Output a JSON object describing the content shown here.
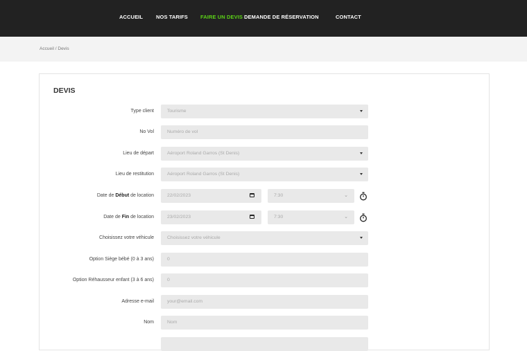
{
  "nav": {
    "items": [
      {
        "label": "ACCUEIL",
        "active": false
      },
      {
        "label": "NOS TARIFS",
        "active": false
      },
      {
        "label": "FAIRE UN DEVIS",
        "active": true
      },
      {
        "label": "DEMANDE DE RÉSERVATION",
        "active": false
      },
      {
        "label": "CONTACT",
        "active": false
      }
    ],
    "colors": {
      "background": "#222222",
      "active": "#5bd117"
    }
  },
  "breadcrumb": "Accueil  /  Devis",
  "form": {
    "title": "DEVIS",
    "type_client": {
      "label": "Type client",
      "value": "Tourisme"
    },
    "no_vol": {
      "label": "No Vol",
      "placeholder": "Numéro de vol"
    },
    "lieu_depart": {
      "label": "Lieu de départ",
      "value": "Aéroport Roland Garros (St Denis)"
    },
    "lieu_restitution": {
      "label": "Lieu de restitution",
      "value": "Aéroport Roland Garros (St Denis)"
    },
    "date_debut": {
      "label_pre": "Date de ",
      "label_bold": "Début",
      "label_post": " de location",
      "date": "22/02/2023",
      "time": "7:30"
    },
    "date_fin": {
      "label_pre": "Date de ",
      "label_bold": "Fin",
      "label_post": " de location",
      "date": "23/02/2023",
      "time": "7:30"
    },
    "vehicule": {
      "label": "Choisissez votre véhicule",
      "value": "Choisissez votre véhicule"
    },
    "siege_bebe": {
      "label": "Option Siège bébé (0 à 3 ans)",
      "value": "0"
    },
    "rehausseur": {
      "label": "Option Réhausseur enfant (3 à 6 ans)",
      "value": "0"
    },
    "email": {
      "label": "Adresse e-mail",
      "placeholder": "your@email.com"
    },
    "nom": {
      "label": "Nom",
      "placeholder": "Nom"
    }
  }
}
